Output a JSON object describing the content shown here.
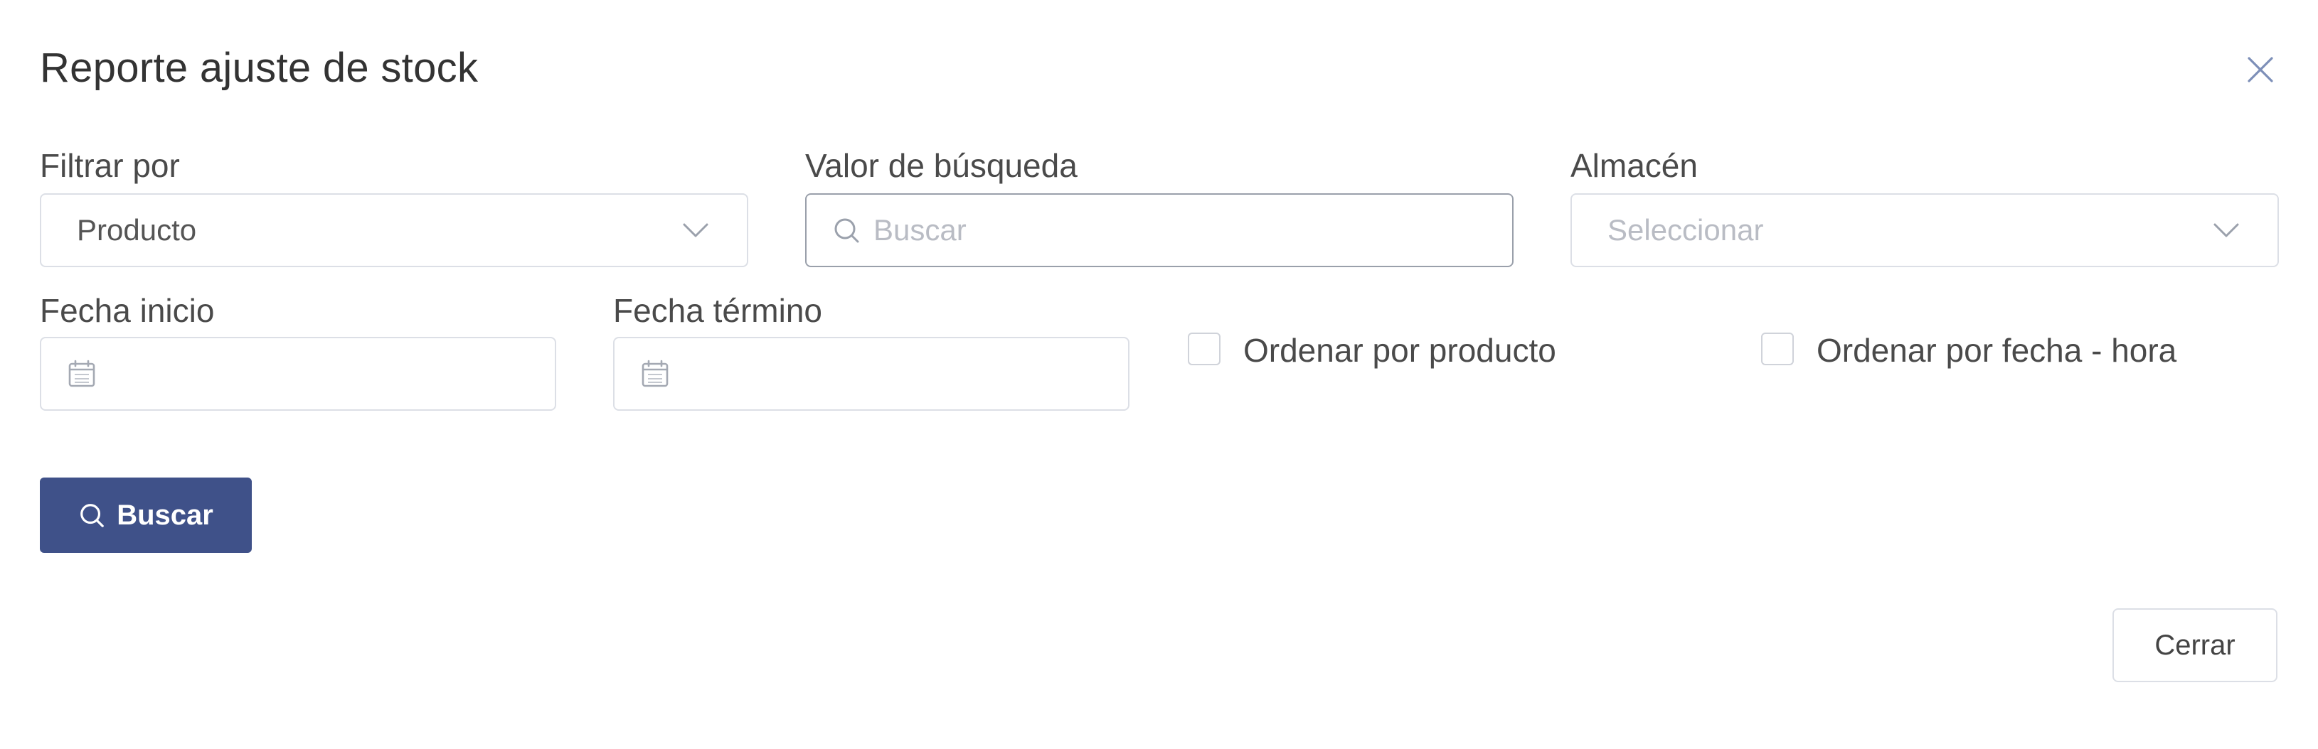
{
  "dialog": {
    "title": "Reporte ajuste de stock"
  },
  "filters": {
    "filter_by": {
      "label": "Filtrar por",
      "value": "Producto",
      "icon": "chevron-down-icon"
    },
    "search_value": {
      "label": "Valor de búsqueda",
      "placeholder": "Buscar",
      "icon": "search-icon"
    },
    "warehouse": {
      "label": "Almacén",
      "placeholder": "Seleccionar",
      "icon": "chevron-down-icon"
    },
    "start_date": {
      "label": "Fecha inicio",
      "value": "",
      "icon": "calendar-icon"
    },
    "end_date": {
      "label": "Fecha término",
      "value": "",
      "icon": "calendar-icon"
    },
    "sort_by_product": {
      "label": "Ordenar por producto",
      "checked": false
    },
    "sort_by_datetime": {
      "label": "Ordenar por fecha - hora",
      "checked": false
    }
  },
  "actions": {
    "search_label": "Buscar",
    "close_label": "Cerrar"
  },
  "colors": {
    "primary": "#3f5189",
    "border": "#dcdfe6",
    "placeholder": "#b9bcc4",
    "close_icon": "#7d8fb8"
  }
}
